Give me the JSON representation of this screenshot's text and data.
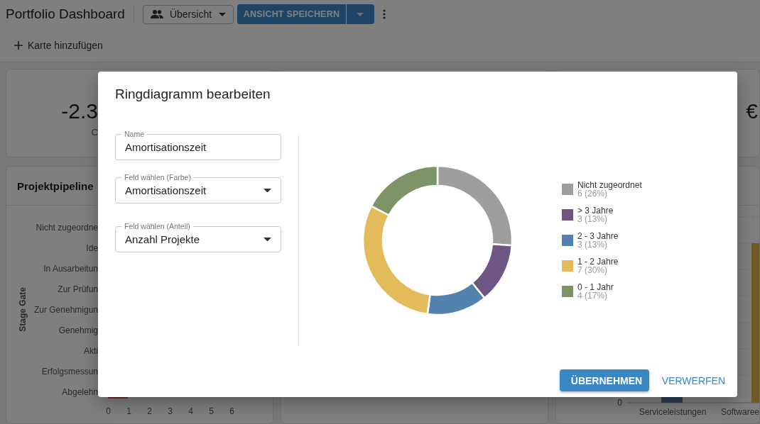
{
  "header": {
    "title": "Portfolio Dashboard",
    "view_selector": {
      "label": "Übersicht"
    },
    "save_button": {
      "label": "ANSICHT SPEICHERN"
    }
  },
  "toolbar": {
    "add_card_button": {
      "label": "Karte hinzufügen"
    }
  },
  "kpi_cards": [
    {
      "value": "-2.3",
      "caption": "C"
    },
    {
      "value": "€"
    }
  ],
  "pipeline_card": {
    "title": "Projektpipeline",
    "y_axis_title": "Stage Gate",
    "y_labels": [
      "Nicht zugeordne",
      "Ide",
      "In Ausarbeitun",
      "Zur Prüfun",
      "Zur Genehmigun",
      "Genehmig",
      "Akti",
      "Erfolgsmessun",
      "Abgelehn"
    ],
    "x_ticks": [
      "0",
      "1",
      "2",
      "3",
      "4",
      "5",
      "6"
    ]
  },
  "category_card": {
    "y_tick": "0",
    "x_labels": [
      "Serviceleistungen",
      "Softwaree"
    ]
  },
  "dialog": {
    "title": "Ringdiagramm bearbeiten",
    "fields": [
      {
        "kind": "text",
        "label": "Name",
        "value": "Amortisationszeit"
      },
      {
        "kind": "select",
        "label": "Feld wählen (Farbe)",
        "value": "Amortisationszeit"
      },
      {
        "kind": "select",
        "label": "Feld wählen (Anteil)",
        "value": "Anzahl Projekte"
      }
    ],
    "chart_data": {
      "type": "donut",
      "categories": [
        "Nicht zugeordnet",
        "> 3 Jahre",
        "2 - 3 Jahre",
        "1 - 2 Jahre",
        "0 - 1 Jahr"
      ],
      "values": [
        6,
        3,
        3,
        7,
        4
      ]
    },
    "legend": [
      {
        "reading": "6 (26%)",
        "color": "#9e9e9e"
      },
      {
        "reading": "3 (13%)",
        "color": "#6d5684"
      },
      {
        "reading": "3 (13%)",
        "color": "#5282ad"
      },
      {
        "reading": "7 (30%)",
        "color": "#e3bb5a"
      },
      {
        "reading": "4 (17%)",
        "color": "#7c9467"
      }
    ],
    "buttons": [
      {
        "kind": "primary",
        "label": "ÜBERNEHMEN"
      },
      {
        "kind": "text",
        "label": "VERWERFEN"
      }
    ]
  }
}
